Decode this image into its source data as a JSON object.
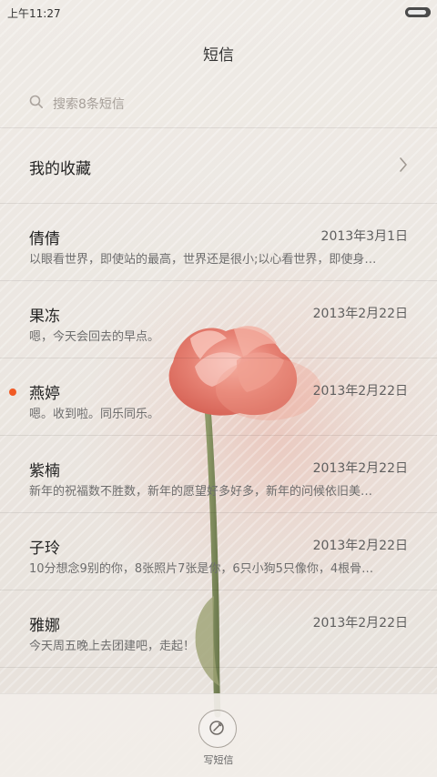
{
  "status_bar": {
    "time": "上午11:27"
  },
  "header": {
    "title": "短信"
  },
  "search": {
    "placeholder": "搜索8条短信"
  },
  "favorites": {
    "label": "我的收藏"
  },
  "messages": [
    {
      "name": "倩倩",
      "date": "2013年3月1日",
      "preview": "以眼看世界，即使站的最高，世界还是很小;以心看世界，即使身…",
      "unread": false
    },
    {
      "name": "果冻",
      "date": "2013年2月22日",
      "preview": "嗯，今天会回去的早点。",
      "unread": false
    },
    {
      "name": "燕婷",
      "date": "2013年2月22日",
      "preview": "嗯。收到啦。同乐同乐。",
      "unread": true
    },
    {
      "name": "紫楠",
      "date": "2013年2月22日",
      "preview": "新年的祝福数不胜数，新年的愿望好多好多，新年的问候依旧美…",
      "unread": false
    },
    {
      "name": "子玲",
      "date": "2013年2月22日",
      "preview": "10分想念9别的你，8张照片7张是你，6只小狗5只像你，4根骨…",
      "unread": false
    },
    {
      "name": "雅娜",
      "date": "2013年2月22日",
      "preview": "今天周五晚上去团建吧，走起！",
      "unread": false
    }
  ],
  "bottom_action": {
    "label": "写短信"
  },
  "icons": {
    "search": "search-icon",
    "chevron": "chevron-right-icon",
    "compose": "compose-icon",
    "battery": "battery-icon"
  },
  "colors": {
    "unread": "#f15a24"
  }
}
